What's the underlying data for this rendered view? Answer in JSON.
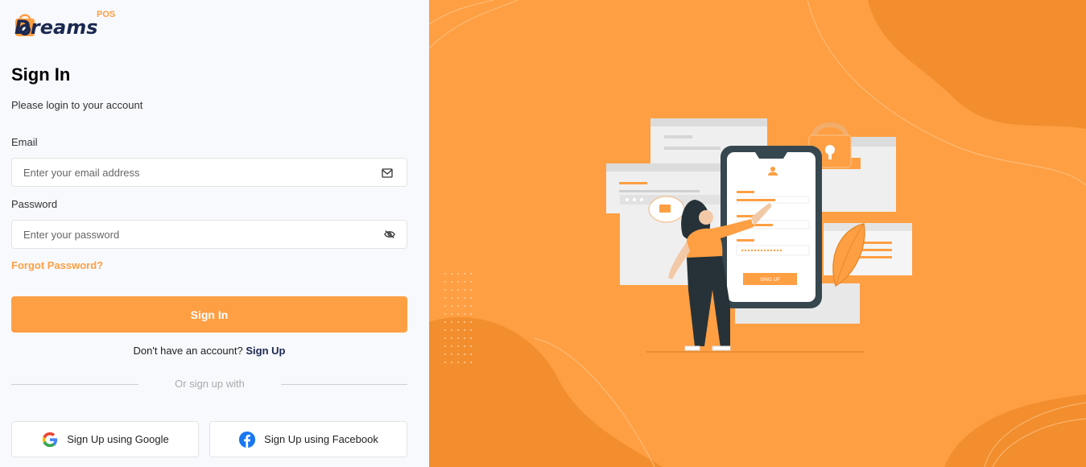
{
  "brand": {
    "name": "Dreams",
    "sub": "POS"
  },
  "form": {
    "title": "Sign In",
    "subtitle": "Please login to your account",
    "email_label": "Email",
    "email_placeholder": "Enter your email address",
    "password_label": "Password",
    "password_placeholder": "Enter your password",
    "forgot": "Forgot Password?",
    "submit": "Sign In",
    "no_account": "Don't have an account?",
    "signup": "Sign Up",
    "or_text": "Or sign up with",
    "google": "Sign Up using Google",
    "facebook": "Sign Up using Facebook"
  },
  "illustration": {
    "button_text": "SING UP"
  },
  "icons": {
    "email": "mail-icon",
    "password": "eye-slash-icon",
    "google": "google-icon",
    "facebook": "facebook-icon"
  },
  "colors": {
    "accent": "#ff9f43",
    "brand_dark": "#1b2850",
    "panel": "#fe9f43"
  }
}
